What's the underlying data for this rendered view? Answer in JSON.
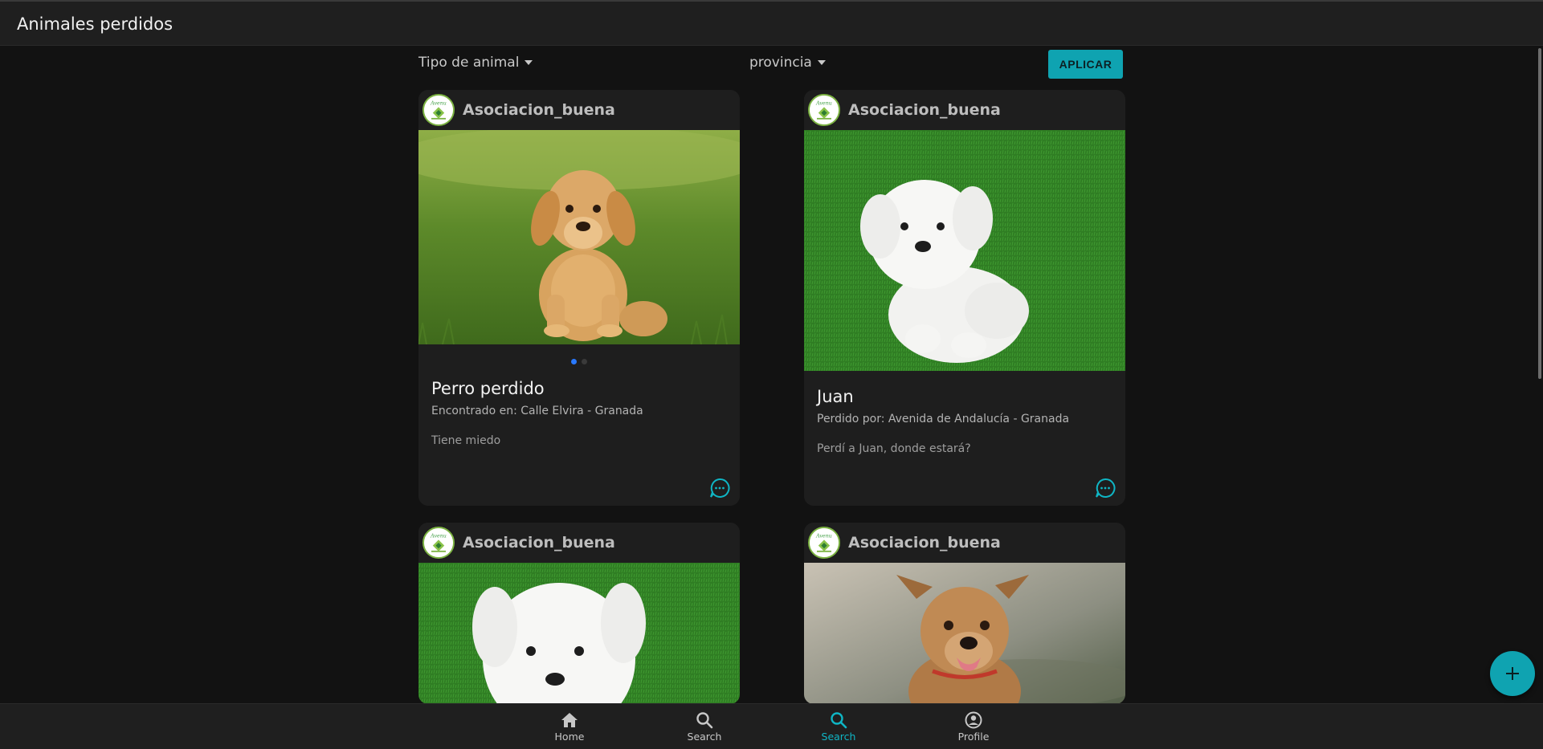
{
  "header": {
    "title": "Animales perdidos"
  },
  "filters": {
    "animal_type_label": "Tipo de animal",
    "province_label": "provincia",
    "apply_label": "APLICAR"
  },
  "posts": [
    {
      "user": "Asociacion_buena",
      "title": "Perro perdido",
      "subtitle": "Encontrado en: Calle Elvira - Granada",
      "description": "Tiene miedo",
      "image": "golden-retriever-puppy-on-grass",
      "carousel": {
        "count": 2,
        "active": 0
      }
    },
    {
      "user": "Asociacion_buena",
      "title": "Juan",
      "subtitle": "Perdido por: Avenida de Andalucía - Granada",
      "description": "Perdí a Juan, donde estará?",
      "image": "white-maltese-puppy-on-grass"
    },
    {
      "user": "Asociacion_buena",
      "image": "white-maltese-puppy-on-grass"
    },
    {
      "user": "Asociacion_buena",
      "image": "brown-dog-smiling-outdoors"
    }
  ],
  "bottom_nav": {
    "items": [
      {
        "label": "Home",
        "icon": "home-icon",
        "active": false
      },
      {
        "label": "Search",
        "icon": "search-icon",
        "active": false
      },
      {
        "label": "Search",
        "icon": "search-icon",
        "active": true
      },
      {
        "label": "Profile",
        "icon": "profile-icon",
        "active": false
      }
    ]
  },
  "fab": {
    "icon": "plus-icon"
  },
  "colors": {
    "accent": "#0fa3b1",
    "active_nav": "#0fb5c4",
    "carousel_active": "#2979ff"
  }
}
